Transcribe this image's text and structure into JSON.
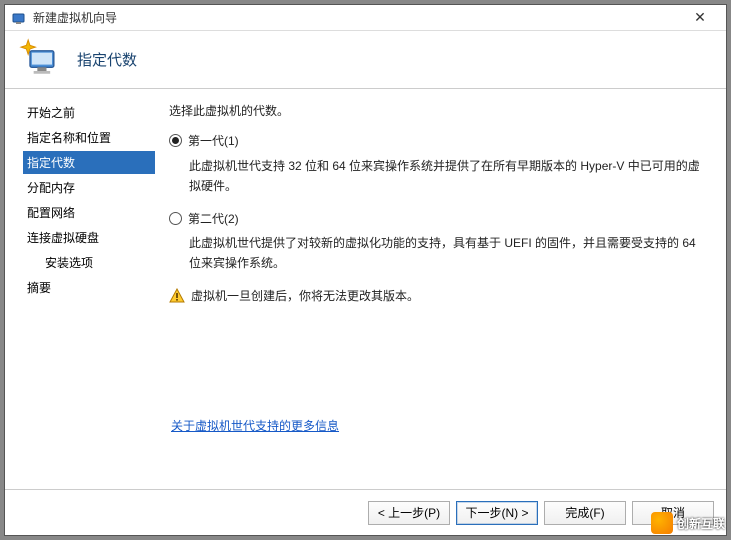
{
  "window": {
    "title": "新建虚拟机向导"
  },
  "header": {
    "page_title": "指定代数"
  },
  "sidebar": {
    "steps": [
      {
        "label": "开始之前"
      },
      {
        "label": "指定名称和位置"
      },
      {
        "label": "指定代数"
      },
      {
        "label": "分配内存"
      },
      {
        "label": "配置网络"
      },
      {
        "label": "连接虚拟硬盘"
      }
    ],
    "substeps": [
      {
        "label": "安装选项"
      }
    ],
    "summary": {
      "label": "摘要"
    }
  },
  "main": {
    "intro": "选择此虚拟机的代数。",
    "option1": {
      "label": "第一代(1)",
      "desc": "此虚拟机世代支持 32 位和 64 位来宾操作系统并提供了在所有早期版本的 Hyper-V 中已可用的虚拟硬件。"
    },
    "option2": {
      "label": "第二代(2)",
      "desc": "此虚拟机世代提供了对较新的虚拟化功能的支持，具有基于 UEFI 的固件，并且需要受支持的 64 位来宾操作系统。"
    },
    "warning": "虚拟机一旦创建后，你将无法更改其版本。",
    "link": "关于虚拟机世代支持的更多信息"
  },
  "footer": {
    "back": "< 上一步(P)",
    "next": "下一步(N) >",
    "finish": "完成(F)",
    "cancel": "取消"
  },
  "watermark": {
    "text": "创新互联"
  }
}
